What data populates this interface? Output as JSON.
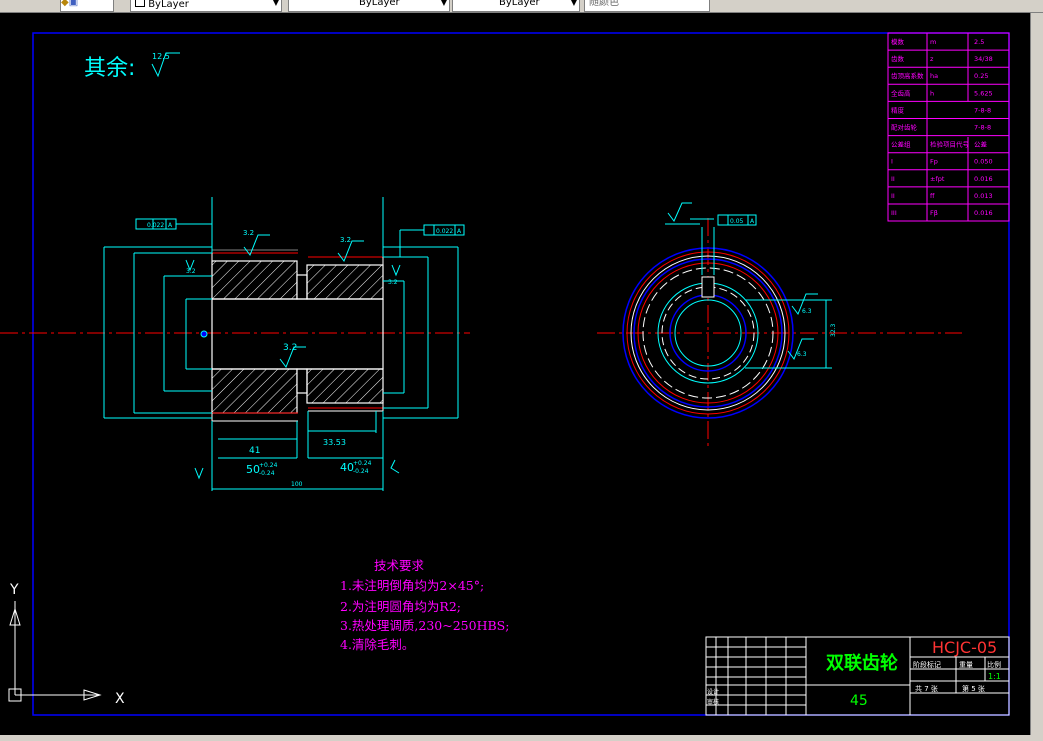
{
  "toolbar": {
    "layer_control_1": "ByLayer",
    "layer_control_2": "ByLayer",
    "layer_control_3": "ByLayer",
    "layer_control_4": "随颜色"
  },
  "drawing": {
    "surface_note": "其余:",
    "surface_note_value": "12.5",
    "tech_requirements": {
      "heading": "技术要求",
      "items": [
        "1.未注明倒角均为2×45°;",
        "2.为注明圆角均为R2;",
        "3.热处理调质,230~250HBS;",
        "4.清除毛刺。"
      ]
    },
    "gear_params": [
      {
        "name": "模数",
        "sym": "m",
        "val": "2.5"
      },
      {
        "name": "齿数",
        "sym": "z",
        "val": "34/38"
      },
      {
        "name": "齿顶高系数",
        "sym": "ha",
        "val": "0.25"
      },
      {
        "name": "全齿高",
        "sym": "h",
        "val": "5.625"
      },
      {
        "name": "精度",
        "sym": "",
        "val": "7-8-8"
      },
      {
        "name": "配对齿轮",
        "sym": "",
        "val": "7-8-8"
      },
      {
        "name": "公差组",
        "sym": "检验项目代号",
        "val": "公差"
      },
      {
        "name": "I",
        "sym": "Fp",
        "val": "0.050"
      },
      {
        "name": "II",
        "sym": "±fpt",
        "val": "0.016"
      },
      {
        "name": "II",
        "sym": "ff",
        "val": "0.013"
      },
      {
        "name": "III",
        "sym": "Fβ",
        "val": "0.016"
      }
    ],
    "title_block": {
      "part_name": "双联齿轮",
      "drawing_number": "HCJC-05",
      "material": "45",
      "scale_label": "比例",
      "scale": "1:1",
      "sheet_total": "共 7 张",
      "sheet_no": "第 5 张",
      "stage_label": "阶段标记",
      "weight_label": "重量",
      "row_design": "设计",
      "row_review": "审核"
    },
    "dims": {
      "d1": "41",
      "d2": "50",
      "d2_tol_upper": "+0.24",
      "d2_tol_lower": "-0.24",
      "d3": "33.53",
      "d4": "40",
      "d4_tol_upper": "+0.24",
      "d4_tol_lower": "-0.24",
      "d5": "100",
      "rough_top1": "3.2",
      "rough_top2": "3.2",
      "rough_mid": "3.2",
      "rough_left": "3.2",
      "rough_right": "3.2",
      "runout_left": "0.022",
      "runout_left_ref": "A",
      "runout_right": "0.022",
      "runout_right_ref": "A",
      "sym_right": "0.05",
      "sym_right_ref": "A",
      "keyway_width": "6.3",
      "keyway_depth": "32.3",
      "rough_side": "6.3"
    },
    "ucs_x": "X",
    "ucs_y": "Y"
  },
  "colors": {
    "background": "#000000",
    "border": "#0000ff",
    "center_line": "#ff0000",
    "outline": "#ffffff",
    "dimension": "#00ffff",
    "table": "#ff00ff",
    "text_green": "#00ff00",
    "text_red": "#ff3333"
  }
}
